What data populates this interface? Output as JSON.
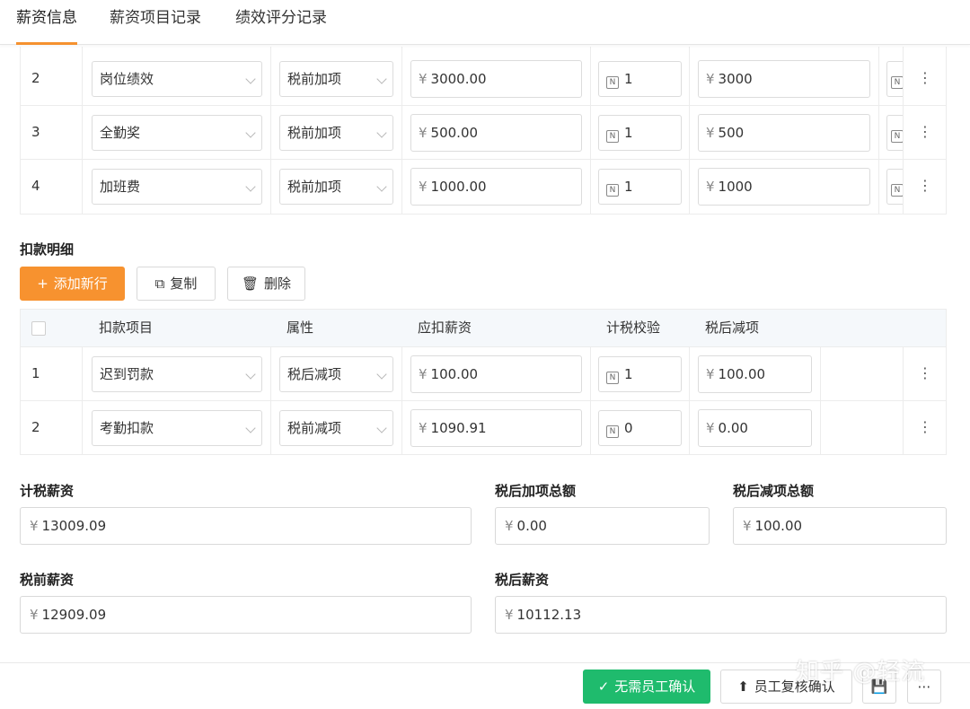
{
  "tabs": [
    {
      "label": "薪资信息"
    },
    {
      "label": "薪资项目记录"
    },
    {
      "label": "绩效评分记录"
    }
  ],
  "income_rows": [
    {
      "index": "2",
      "item": "岗位绩效",
      "attr": "税前加项",
      "amount": "3000.00",
      "factor": "1",
      "total": "3000"
    },
    {
      "index": "3",
      "item": "全勤奖",
      "attr": "税前加项",
      "amount": "500.00",
      "factor": "1",
      "total": "500"
    },
    {
      "index": "4",
      "item": "加班费",
      "attr": "税前加项",
      "amount": "1000.00",
      "factor": "1",
      "total": "1000"
    }
  ],
  "deduction": {
    "title": "扣款明细",
    "add_label": "添加新行",
    "copy_label": "复制",
    "delete_label": "删除",
    "headers": [
      "扣款项目",
      "属性",
      "应扣薪资",
      "计税校验",
      "税后减项"
    ],
    "rows": [
      {
        "index": "1",
        "item": "迟到罚款",
        "attr": "税后减项",
        "amount": "100.00",
        "factor": "1",
        "after_tax": "100.00"
      },
      {
        "index": "2",
        "item": "考勤扣款",
        "attr": "税前减项",
        "amount": "1090.91",
        "factor": "0",
        "after_tax": "0.00"
      }
    ]
  },
  "summary": {
    "taxable_label": "计税薪资",
    "taxable_value": "13009.09",
    "after_tax_add_label": "税后加项总额",
    "after_tax_add_value": "0.00",
    "after_tax_sub_label": "税后减项总额",
    "after_tax_sub_value": "100.00",
    "pre_tax_label": "税前薪资",
    "pre_tax_value": "12909.09",
    "post_tax_label": "税后薪资",
    "post_tax_value": "10112.13"
  },
  "currency_symbol": "¥",
  "number_icon": "N",
  "footer": {
    "no_confirm_label": "无需员工确认",
    "review_label": "员工复核确认"
  },
  "watermark": "知乎 @轻流",
  "colors": {
    "accent": "#f7922f",
    "green": "#1fbb6d"
  }
}
